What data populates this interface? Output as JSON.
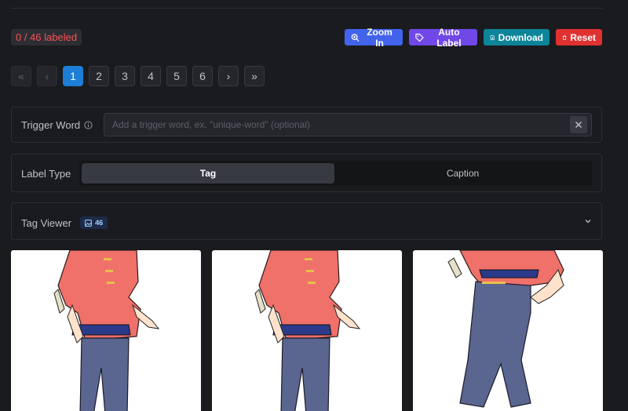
{
  "status": {
    "labeled_text": "0 / 46 labeled"
  },
  "actions": {
    "zoom_in": "Zoom In",
    "auto_label": "Auto Label",
    "download": "Download",
    "reset": "Reset"
  },
  "pagination": {
    "first": "«",
    "prev": "‹",
    "pages": [
      "1",
      "2",
      "3",
      "4",
      "5",
      "6"
    ],
    "next": "›",
    "last": "»",
    "current": "1"
  },
  "trigger_word": {
    "label": "Trigger Word",
    "placeholder": "Add a trigger word, ex. \"unique-word\" (optional)",
    "value": ""
  },
  "label_type": {
    "label": "Label Type",
    "options": [
      "Tag",
      "Caption"
    ],
    "selected": "Tag"
  },
  "tag_viewer": {
    "label": "Tag Viewer",
    "count": "46"
  },
  "images": [
    {
      "alt": "image-1"
    },
    {
      "alt": "image-2"
    },
    {
      "alt": "image-3"
    }
  ],
  "colors": {
    "background": "#1a1b1e",
    "zoom_in": "#4263eb",
    "auto_label": "#7048e8",
    "download": "#0c8599",
    "reset": "#e03131",
    "active_page": "#1c7ed6",
    "status_text": "#fa5252"
  }
}
